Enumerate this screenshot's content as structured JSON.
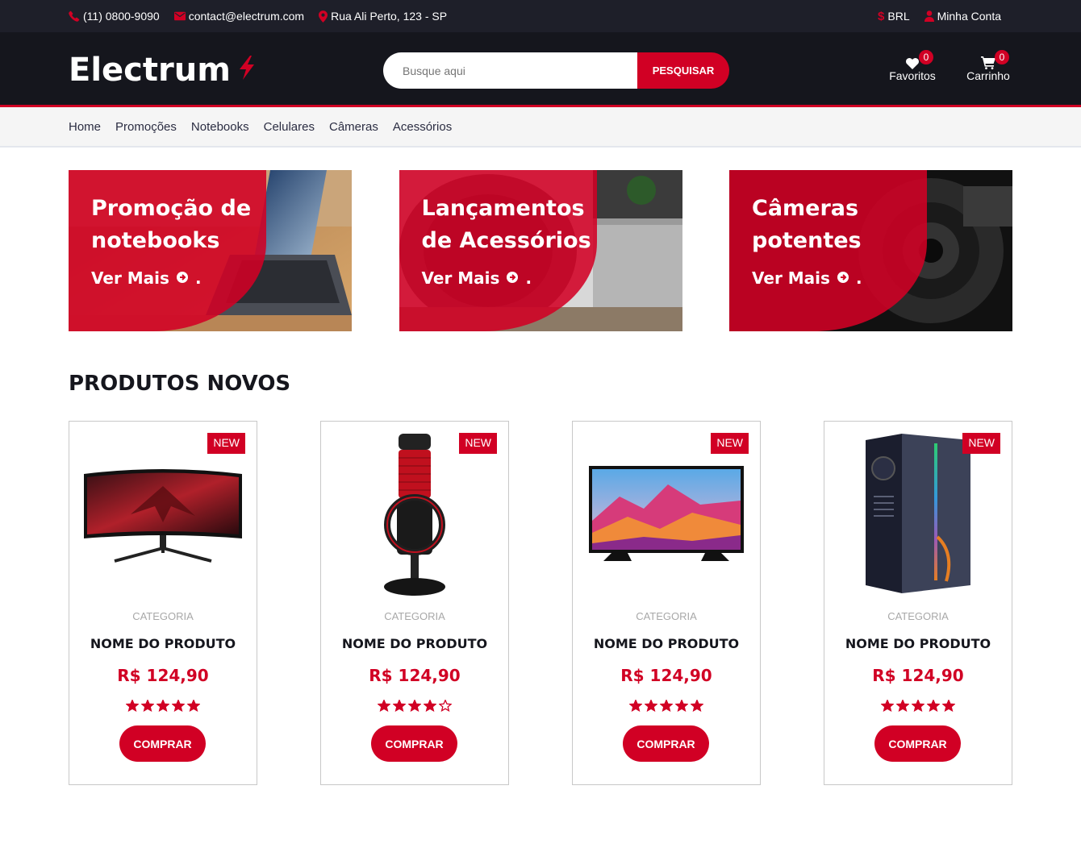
{
  "topbar": {
    "phone": "(11) 0800-9090",
    "email": "contact@electrum.com",
    "address": "Rua Ali Perto, 123 - SP",
    "currency": "BRL",
    "account": "Minha Conta"
  },
  "header": {
    "logo": "Electrum",
    "search_placeholder": "Busque aqui",
    "search_button": "PESQUISAR",
    "favorites_label": "Favoritos",
    "favorites_count": "0",
    "cart_label": "Carrinho",
    "cart_count": "0"
  },
  "nav": {
    "items": [
      "Home",
      "Promoções",
      "Notebooks",
      "Celulares",
      "Câmeras",
      "Acessórios"
    ]
  },
  "banners": [
    {
      "line1": "Promoção de",
      "line2": "notebooks",
      "more": "Ver Mais"
    },
    {
      "line1": "Lançamentos",
      "line2": "de Acessórios",
      "more": "Ver Mais"
    },
    {
      "line1": "Câmeras",
      "line2": "potentes",
      "more": "Ver Mais"
    }
  ],
  "section_title": "PRODUTOS NOVOS",
  "products": [
    {
      "badge": "NEW",
      "category": "CATEGORIA",
      "name": "NOME DO PRODUTO",
      "price": "R$ 124,90",
      "rating": 5,
      "buy": "COMPRAR",
      "image": "monitor-image"
    },
    {
      "badge": "NEW",
      "category": "CATEGORIA",
      "name": "NOME DO PRODUTO",
      "price": "R$ 124,90",
      "rating": 4,
      "buy": "COMPRAR",
      "image": "microphone-image"
    },
    {
      "badge": "NEW",
      "category": "CATEGORIA",
      "name": "NOME DO PRODUTO",
      "price": "R$ 124,90",
      "rating": 5,
      "buy": "COMPRAR",
      "image": "tv-image"
    },
    {
      "badge": "NEW",
      "category": "CATEGORIA",
      "name": "NOME DO PRODUTO",
      "price": "R$ 124,90",
      "rating": 5,
      "buy": "COMPRAR",
      "image": "pc-case-image"
    }
  ],
  "colors": {
    "accent": "#d10024",
    "topbar_bg": "#1e1f29",
    "header_bg": "#15161d",
    "nav_bg": "#f5f5f5"
  }
}
